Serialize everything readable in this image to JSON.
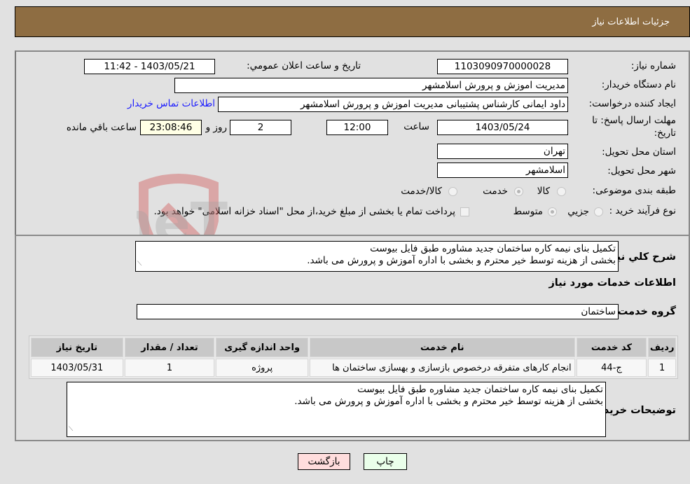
{
  "header": {
    "title": "جزئیات اطلاعات نیاز"
  },
  "form": {
    "need_number_label": "شماره نیاز:",
    "need_number": "1103090970000028",
    "announce_label": "تاریخ و ساعت اعلان عمومي:",
    "announce_value": "1403/05/21 - 11:42",
    "buyer_org_label": "نام دستگاه خریدار:",
    "buyer_org": "مدیریت اموزش و پرورش اسلامشهر",
    "requester_label": "ایجاد کننده درخواست:",
    "requester": "داود ایمانی کارشناس پشتیبانی مدیریت اموزش و پرورش اسلامشهر",
    "contact_link": "اطلاعات تماس خریدار",
    "deadline_label_1": "مهلت ارسال پاسخ: تا",
    "deadline_label_2": "تاریخ:",
    "deadline_date": "1403/05/24",
    "time_label": "ساعت",
    "deadline_time": "12:00",
    "days_value": "2",
    "days_label": "روز و",
    "remaining_time": "23:08:46",
    "remaining_label": "ساعت باقي مانده",
    "province_label": "استان محل تحویل:",
    "province": "تهران",
    "city_label": "شهر محل تحویل:",
    "city": "اسلامشهر",
    "category_label": "طبقه بندی موضوعی:",
    "category_options": [
      {
        "label": "کالا",
        "checked": false
      },
      {
        "label": "خدمت",
        "checked": true
      },
      {
        "label": "کالا/خدمت",
        "checked": false
      }
    ],
    "process_label": "نوع فرآیند خرید :",
    "process_options": [
      {
        "label": "جزيي",
        "checked": false
      },
      {
        "label": "متوسط",
        "checked": true
      }
    ],
    "treasury_note": "پرداخت تمام یا بخشی از مبلغ خرید،از محل \"اسناد خزانه اسلامی\" خواهد بود.",
    "treasury_checked": false
  },
  "details": {
    "description_label": "شرح کلي نیاز:",
    "description_line1": "تکمیل بنای نیمه کاره ساختمان جدید مشاوره طبق فایل بیوست",
    "description_line2": "بخشی از هزینه توسط خیر محترم و بخشی با اداره آموزش و پرورش می باشد.",
    "services_heading": "اطلاعات خدمات مورد نیاز",
    "service_group_label": "گروه خدمت:",
    "service_group": "ساختمان",
    "table": {
      "headers": [
        "ردیف",
        "کد خدمت",
        "نام خدمت",
        "واحد اندازه گیری",
        "تعداد / مقدار",
        "تاریخ نیاز"
      ],
      "rows": [
        [
          "1",
          "ج-44",
          "انجام کارهای متفرقه درخصوص بازسازی و بهسازی ساختمان ها",
          "پروژه",
          "1",
          "1403/05/31"
        ]
      ]
    },
    "buyer_notes_label": "توضیحات خریدار:",
    "buyer_notes_line1": "تکمیل بنای نیمه کاره ساختمان جدید مشاوره طبق فایل بیوست",
    "buyer_notes_line2": "بخشی از هزینه توسط خیر محترم و بخشی با اداره آموزش و پرورش می باشد."
  },
  "buttons": {
    "print": "چاپ",
    "back": "بازگشت"
  },
  "watermark": {
    "text": "AriaTender.neT"
  },
  "colors": {
    "header_bg": "#8e6d42",
    "print_bg": "#eaffea",
    "back_bg": "#ffdddd",
    "link": "#1a1aff"
  }
}
